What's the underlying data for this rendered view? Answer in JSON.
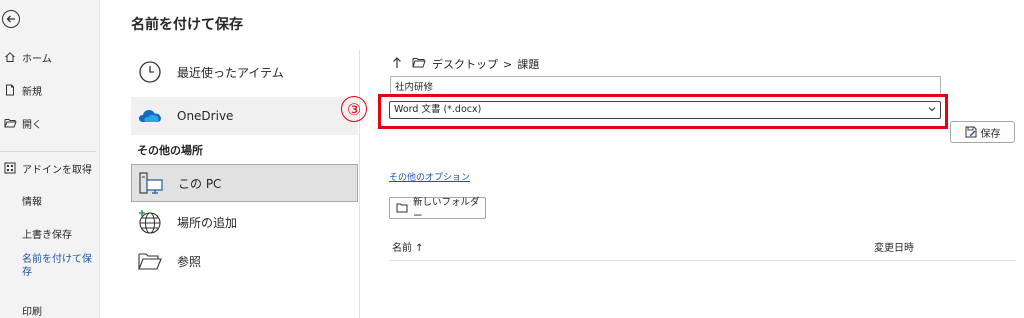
{
  "nav": {
    "items": [
      {
        "label": "ホーム",
        "icon": "home-icon"
      },
      {
        "label": "新規",
        "icon": "new-document-icon"
      },
      {
        "label": "開く",
        "icon": "open-folder-icon"
      },
      {
        "label": "アドインを取得",
        "icon": "addins-grid-icon"
      },
      {
        "label": "情報"
      },
      {
        "label": "上書き保存"
      },
      {
        "label": "名前を付けて保\n存"
      },
      {
        "label": "印刷"
      }
    ]
  },
  "page": {
    "title": "名前を付けて保存"
  },
  "locations": {
    "recent": "最近使ったアイテム",
    "onedrive": "OneDrive",
    "other_heading": "その他の場所",
    "this_pc": "この PC",
    "add_place": "場所の追加",
    "browse": "参照"
  },
  "breadcrumb": {
    "folder": "デスクトップ",
    "separator": ">",
    "subfolder": "課題"
  },
  "file": {
    "name": "社内研修",
    "type": "Word 文書 (*.docx)"
  },
  "annotation": {
    "step": "③",
    "color": "#e60012"
  },
  "actions": {
    "save": "保存",
    "more_options": "その他のオプション",
    "new_folder": "新しいフォルダー"
  },
  "list": {
    "col_name": "名前 ↑",
    "col_modified": "変更日時"
  },
  "colors": {
    "accent": "#1f55a7",
    "onedrive": "#0f6cbd",
    "annotation": "#e60012"
  }
}
